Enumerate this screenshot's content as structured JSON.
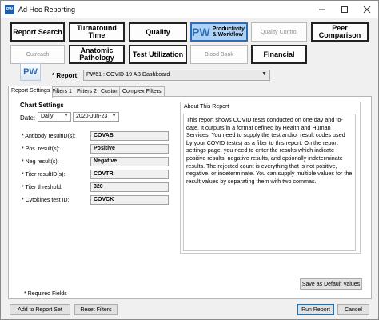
{
  "window": {
    "title": "Ad Hoc Reporting",
    "icon_label": "PW"
  },
  "categories": [
    {
      "label": "Report Search",
      "enabled": true
    },
    {
      "label": "Turnaround Time",
      "enabled": true
    },
    {
      "label": "Quality",
      "enabled": true
    },
    {
      "badge": "PW",
      "label": "Productivity & Workflow",
      "enabled": true,
      "selected": true
    },
    {
      "label": "Quality Control",
      "enabled": false
    },
    {
      "label": "Peer Comparison",
      "enabled": true
    },
    {
      "label": "Outreach",
      "enabled": false
    },
    {
      "label": "Anatomic Pathology",
      "enabled": true
    },
    {
      "label": "Test Utilization",
      "enabled": true
    },
    {
      "label": "Blood Bank",
      "enabled": false
    },
    {
      "label": "Financial",
      "enabled": true
    }
  ],
  "report": {
    "logo_text": "PW",
    "label": "* Report:",
    "selected": "PW61 : COVID-19 AB Dashboard"
  },
  "tabs": [
    "Report Settings",
    "Filters 1",
    "Filters 2",
    "Custom",
    "Complex Filters"
  ],
  "chart_settings": {
    "title": "Chart Settings",
    "date_label": "Date:",
    "date_mode": "Daily",
    "date_value": "2020-Jun-23",
    "fields": [
      {
        "label": "* Antibody resultID(s):",
        "value": "COVAB"
      },
      {
        "label": "* Pos. result(s):",
        "value": "Positive"
      },
      {
        "label": "* Neg result(s):",
        "value": "Negative"
      },
      {
        "label": "* Titer resultID(s):",
        "value": "COVTR"
      },
      {
        "label": "* Titer threshold:",
        "value": "320"
      },
      {
        "label": "* Cytokines test ID:",
        "value": "COVCK"
      }
    ]
  },
  "about": {
    "title": "About This Report",
    "text": "This report shows COVID tests conducted on one day and to-date. It outputs in a format defined by Health and Human Services. You need to supply the test and/or result codes used by your COVID test(s) as a filter to this report. On the report settings page, you need to enter the results which indicate positive results, negative results, and optionally indeterminate results. The rejected count is everything that is not positive, negative, or indeterminate. You can supply multiple values for the result values by separating them with two commas."
  },
  "buttons": {
    "save_defaults": "Save as Default Values",
    "add_to_set": "Add to Report Set",
    "reset_filters": "Reset Filters",
    "run_report": "Run Report",
    "cancel": "Cancel"
  },
  "required_note": "* Required Fields"
}
